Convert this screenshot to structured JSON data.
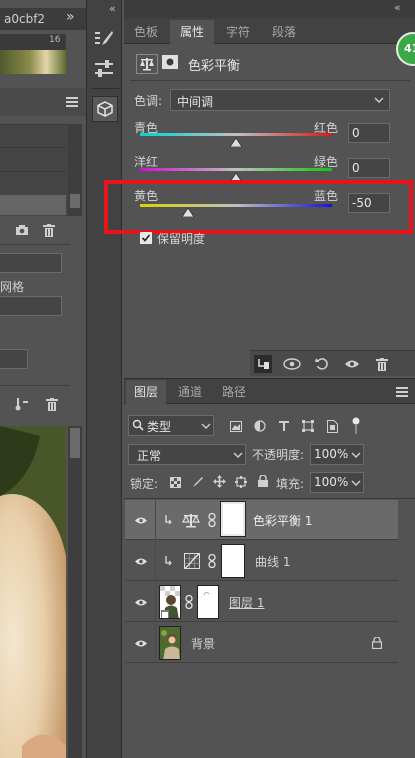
{
  "left_panel": {
    "doc_tab_title": "a0cbf2",
    "collapse_glyph": "»",
    "ruler_number": "16",
    "grid_label": "网格"
  },
  "tool_strip": {
    "collapse_glyph": "«",
    "icons": [
      "brush-settings-icon",
      "adjust-sliders-icon",
      "3d-cube-icon"
    ]
  },
  "properties": {
    "tabs": [
      "色板",
      "属性",
      "字符",
      "段落"
    ],
    "active_tab": "属性",
    "header_title": "色彩平衡",
    "tone_label": "色调:",
    "tone_value": "中间调",
    "sliders": [
      {
        "left": "青色",
        "right": "红色",
        "value": "0",
        "position": 0.5
      },
      {
        "left": "洋红",
        "right": "绿色",
        "value": "0",
        "position": 0.5
      },
      {
        "left": "黄色",
        "right": "蓝色",
        "value": "-50",
        "position": 0.25
      }
    ],
    "preserve_label": "保留明度",
    "preserve_checked": true,
    "highlight_color": "#e8141c"
  },
  "layers": {
    "tabs": [
      "图层",
      "通道",
      "路径"
    ],
    "active_tab": "图层",
    "filter_label": "类型",
    "blend_mode": "正常",
    "opacity_label": "不透明度:",
    "opacity_value": "100%",
    "lock_label": "锁定:",
    "fill_label": "填充:",
    "fill_value": "100%",
    "items": [
      {
        "name": "色彩平衡 1",
        "kind": "adjustment-balance",
        "selected": true
      },
      {
        "name": "曲线 1",
        "kind": "adjustment-curves",
        "selected": false
      },
      {
        "name": "图层 1",
        "kind": "pixel-masked",
        "selected": false
      },
      {
        "name": "背景",
        "kind": "background",
        "selected": false
      }
    ]
  },
  "badge": {
    "text": "41"
  }
}
